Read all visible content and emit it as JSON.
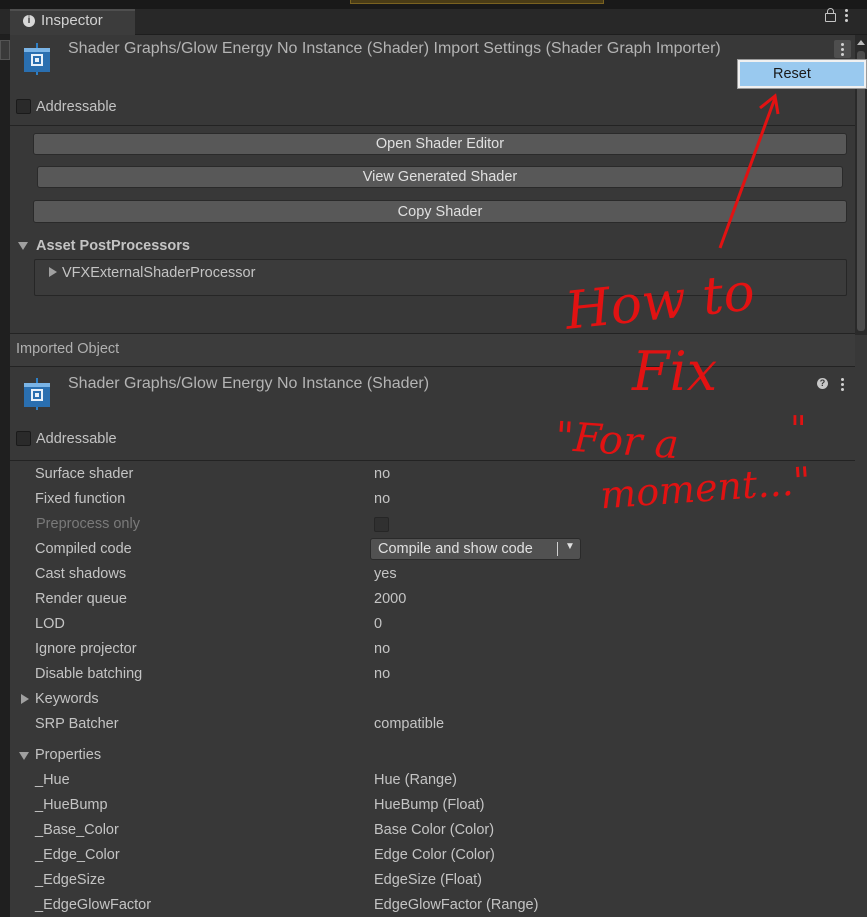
{
  "window": {
    "tab_title": "Inspector",
    "tab_icon": "info-icon"
  },
  "importer": {
    "title": "Shader Graphs/Glow Energy No Instance (Shader) Import Settings (Shader Graph Importer)",
    "addressable_label": "Addressable",
    "addressable_checked": false,
    "buttons": {
      "open_editor": "Open Shader Editor",
      "view_generated": "View Generated Shader",
      "copy_shader": "Copy Shader"
    },
    "postprocessors": {
      "label": "Asset PostProcessors",
      "items": [
        "VFXExternalShaderProcessor"
      ]
    }
  },
  "context_menu": {
    "items": [
      "Reset"
    ],
    "highlighted": "Reset"
  },
  "imported_object": {
    "section_label": "Imported Object",
    "title": "Shader Graphs/Glow Energy No Instance (Shader)",
    "addressable_label": "Addressable",
    "addressable_checked": false,
    "rows": [
      {
        "label": "Surface shader",
        "value": "no"
      },
      {
        "label": "Fixed function",
        "value": "no"
      },
      {
        "label": "Preprocess only",
        "value": ""
      },
      {
        "label": "Compiled code",
        "value": "Compile and show code"
      },
      {
        "label": "Cast shadows",
        "value": "yes"
      },
      {
        "label": "Render queue",
        "value": "2000"
      },
      {
        "label": "LOD",
        "value": "0"
      },
      {
        "label": "Ignore projector",
        "value": "no"
      },
      {
        "label": "Disable batching",
        "value": "no"
      },
      {
        "label": "Keywords",
        "value": ""
      },
      {
        "label": "SRP Batcher",
        "value": "compatible"
      }
    ],
    "properties": {
      "label": "Properties",
      "items": [
        {
          "name": "_Hue",
          "value": "Hue (Range)"
        },
        {
          "name": "_HueBump",
          "value": "HueBump (Float)"
        },
        {
          "name": "_Base_Color",
          "value": "Base Color (Color)"
        },
        {
          "name": "_Edge_Color",
          "value": "Edge Color (Color)"
        },
        {
          "name": "_EdgeSize",
          "value": "EdgeSize (Float)"
        },
        {
          "name": "_EdgeGlowFactor",
          "value": "EdgeGlowFactor (Range)"
        }
      ]
    }
  },
  "annotation": {
    "lines": [
      "How to",
      "Fix",
      "\"For a",
      "\"",
      "moment...\""
    ],
    "color": "#e21212"
  },
  "colors": {
    "panel_bg": "#383838",
    "menu_highlight": "#99c9ef",
    "shader_icon_blue": "#2a6fb0"
  }
}
